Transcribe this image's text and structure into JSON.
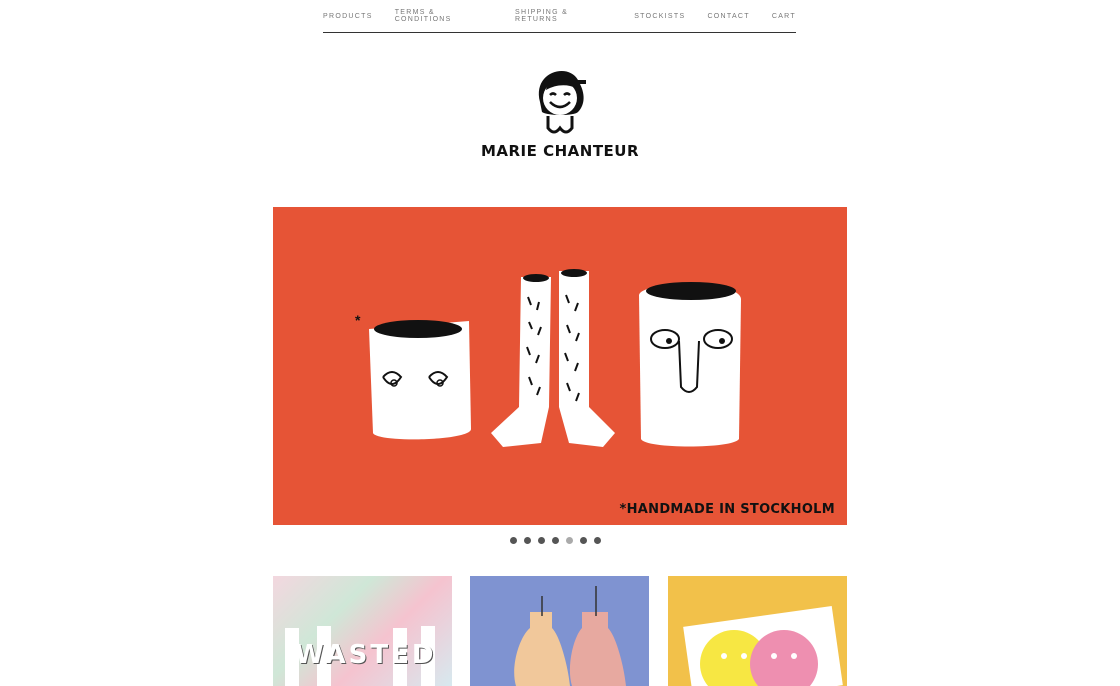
{
  "nav": {
    "items": [
      {
        "label": "PRODUCTS"
      },
      {
        "label": "TERMS & CONDITIONS"
      },
      {
        "label": "SHIPPING & RETURNS"
      },
      {
        "label": "STOCKISTS"
      },
      {
        "label": "CONTACT"
      },
      {
        "label": "CART"
      }
    ]
  },
  "logo": {
    "wordmark": "MARIE CHANTEUR",
    "icon": "smiling-girl-icon"
  },
  "hero": {
    "caption": "*HANDMADE IN STOCKHOLM",
    "background_color": "#e65436",
    "slide_count": 7,
    "active_slide": 5
  },
  "tiles": [
    {
      "label": "WASTED",
      "icon": "wasted-socks-image"
    },
    {
      "icon": "checkered-earrings-image"
    },
    {
      "icon": "smiley-faces-card-image"
    }
  ]
}
